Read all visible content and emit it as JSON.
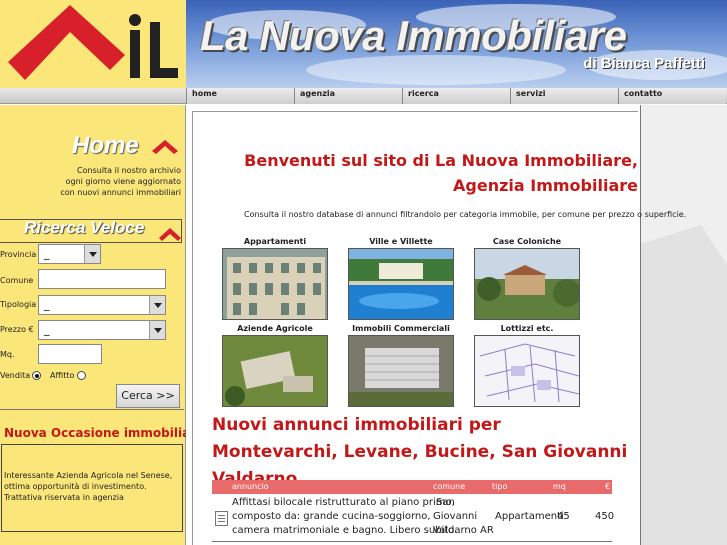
{
  "header": {
    "brand": "La Nuova Immobiliare",
    "byline": "di Bianca Paffetti",
    "logo_letters": "iL"
  },
  "nav": {
    "items": [
      {
        "label": "home"
      },
      {
        "label": "agenzia"
      },
      {
        "label": "ricerca"
      },
      {
        "label": "servizi"
      },
      {
        "label": "contatto"
      }
    ]
  },
  "sidebar": {
    "home_title": "Home",
    "home_text": [
      "Consulta il nostro archivio",
      "ogni giorno viene aggiornato",
      "con nuovi annunci immobiliari"
    ],
    "search_title": "Ricerca Veloce",
    "labels": {
      "provincia": "Provincia",
      "comune": "Comune",
      "tipologia": "Tipologia",
      "prezzo": "Prezzo €",
      "mq": "Mq.",
      "vendita": "Vendita",
      "affitto": "Affitto"
    },
    "selects": {
      "provincia": "_",
      "tipologia": "_",
      "prezzo": "_"
    },
    "search_button": "Cerca >>",
    "occasion_title": "Nuova Occasione immobiliare",
    "occasion_text": "Interessante Azienda Agricola nel Senese, ottima opportunità di investimento. Trattativa riservata in agenzia"
  },
  "main": {
    "welcome": "Benvenuti sul sito di La Nuova Immobiliare, Agenzia Immobiliare",
    "consult": "Consulta il nostro database di annunci filtrandolo per categoria immobile, per comune per prezzo o superficie.",
    "categories": [
      {
        "label": "Appartamenti",
        "icon": "apartment-photo"
      },
      {
        "label": "Ville e Villette",
        "icon": "villa-pool-photo"
      },
      {
        "label": "Case Coloniche",
        "icon": "farmhouse-photo"
      },
      {
        "label": "Aziende Agricole",
        "icon": "farm-aerial-photo"
      },
      {
        "label": "Immobili Commerciali",
        "icon": "commercial-aerial-photo"
      },
      {
        "label": "Lottizzi etc.",
        "icon": "plot-map-photo"
      }
    ],
    "news_title": "Nuovi annunci immobiliari per Montevarchi, Levane, Bucine, San Giovanni Valdarno",
    "table": {
      "headers": [
        "annuncio",
        "comune",
        "tipo",
        "mq",
        "€"
      ],
      "rows": [
        {
          "annuncio": [
            "Affittasi bilocale ristrutturato al piano primo,",
            "composto da: grande cucina-soggiorno,",
            "camera matrimoniale e bagno. Libero subito."
          ],
          "comune": [
            "San",
            "Giovanni",
            "Valdarno AR"
          ],
          "tipo": "Appartamenti",
          "mq": "45",
          "prezzo": "450"
        }
      ]
    }
  },
  "colors": {
    "accent_red": "#c41818",
    "sidebar_yellow": "#fbe67a",
    "table_header": "#e96a6a"
  }
}
